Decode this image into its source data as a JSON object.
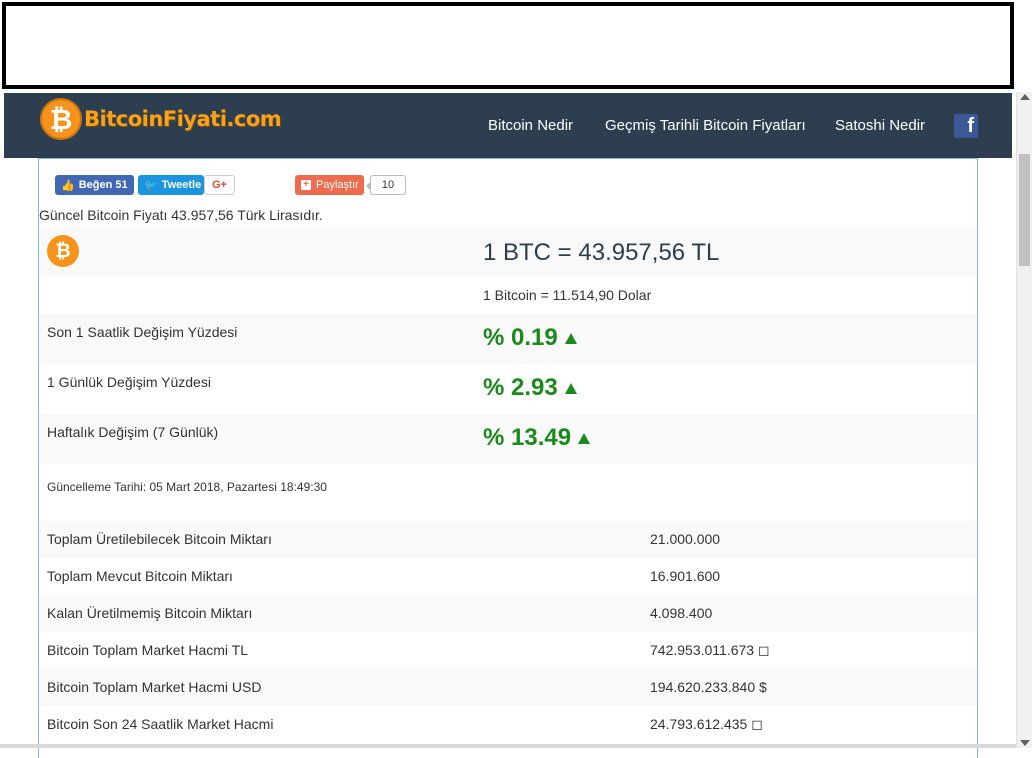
{
  "site": {
    "logo_text": "BitcoinFiyati.com",
    "logo_symbol": "₿"
  },
  "nav": {
    "items": [
      {
        "label": "Bitcoin Nedir"
      },
      {
        "label": "Geçmiş Tarihli Bitcoin Fiyatları"
      },
      {
        "label": "Satoshi Nedir"
      }
    ],
    "facebook_glyph": "f"
  },
  "social": {
    "like_label": "Beğen 51",
    "tweet_label": "Tweetle",
    "gplus_label": "G+",
    "share_label": "Paylaştır",
    "share_count": "10"
  },
  "intro_text": "Güncel Bitcoin Fiyatı 43.957,56 Türk Lirasıdır.",
  "price": {
    "coin_symbol": "₿",
    "btc_try": "1 BTC = 43.957,56 TL",
    "btc_usd": "1 Bitcoin = 11.514,90 Dolar"
  },
  "changes": [
    {
      "label": "Son 1 Saatlik Değişim Yüzdesi",
      "value": "% 0.19",
      "direction": "up"
    },
    {
      "label": "1 Günlük Değişim Yüzdesi",
      "value": "% 2.93",
      "direction": "up"
    },
    {
      "label": "Haftalık Değişim (7 Günlük)",
      "value": "% 13.49",
      "direction": "up"
    }
  ],
  "update_text": "Güncelleme Tarihi: 05 Mart 2018, Pazartesi 18:49:30",
  "stats": [
    {
      "label": "Toplam Üretilebilecek Bitcoin Miktarı",
      "value": "21.000.000"
    },
    {
      "label": "Toplam Mevcut Bitcoin Miktarı",
      "value": "16.901.600"
    },
    {
      "label": "Kalan Üretilmemiş Bitcoin Miktarı",
      "value": "4.098.400"
    },
    {
      "label": "Bitcoin Toplam Market Hacmi TL",
      "value": "742.953.011.673 ◻"
    },
    {
      "label": "Bitcoin Toplam Market Hacmi USD",
      "value": "194.620.233.840 $"
    },
    {
      "label": "Bitcoin Son 24 Saatlik Market Hacmi",
      "value": "24.793.612.435 ◻"
    }
  ],
  "colors": {
    "navbar": "#2c3e50",
    "positive": "#1a8a1a",
    "bitcoin_orange": "#f7931a",
    "content_border": "#7fbde0"
  }
}
